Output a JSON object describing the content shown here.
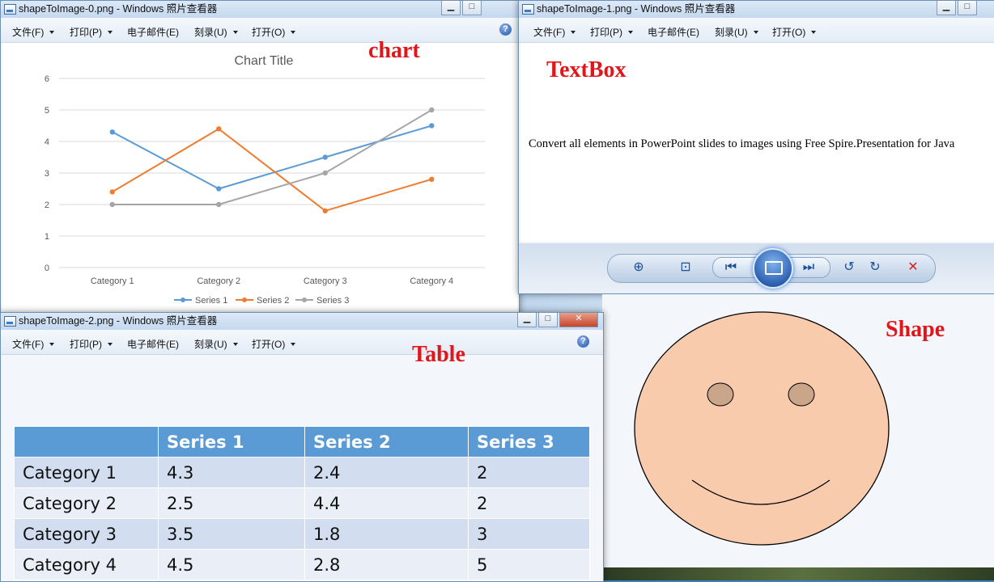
{
  "menu": [
    "文件(F)",
    "打印(P)",
    "电子邮件(E)",
    "刻录(U)",
    "打开(O)"
  ],
  "help_glyph": "?",
  "window_chart": {
    "title": "shapeToImage-0.png - Windows 照片查看器",
    "label": "chart"
  },
  "window_textbox": {
    "title": "shapeToImage-1.png - Windows 照片查看器",
    "label": "TextBox",
    "text": "Convert all elements in PowerPoint slides to images using Free Spire.Presentation for Java"
  },
  "window_table": {
    "title": "shapeToImage-2.png - Windows 照片查看器",
    "label": "Table",
    "headers": [
      "",
      "Series 1",
      "Series 2",
      "Series 3"
    ],
    "rows": [
      [
        "Category 1",
        "4.3",
        "2.4",
        "2"
      ],
      [
        "Category 2",
        "2.5",
        "4.4",
        "2"
      ],
      [
        "Category 3",
        "3.5",
        "1.8",
        "3"
      ],
      [
        "Category 4",
        "4.5",
        "2.8",
        "5"
      ]
    ]
  },
  "shape_label": "Shape",
  "colors": {
    "series1": "#5b9bd5",
    "series2": "#ed7d31",
    "series3": "#a5a5a5",
    "label_red": "#e0161a",
    "face": "#f8cbad",
    "eyes": "#c9a58a"
  },
  "chart_data": {
    "type": "line",
    "title": "Chart Title",
    "categories": [
      "Category 1",
      "Category 2",
      "Category 3",
      "Category 4"
    ],
    "series": [
      {
        "name": "Series 1",
        "values": [
          4.3,
          2.5,
          3.5,
          4.5
        ]
      },
      {
        "name": "Series 2",
        "values": [
          2.4,
          4.4,
          1.8,
          2.8
        ]
      },
      {
        "name": "Series 3",
        "values": [
          2,
          2,
          3,
          5
        ]
      }
    ],
    "yticks": [
      "0",
      "1",
      "2",
      "3",
      "4",
      "5",
      "6"
    ],
    "ylim": [
      0,
      6
    ],
    "grid": true,
    "legend": "bottom"
  }
}
